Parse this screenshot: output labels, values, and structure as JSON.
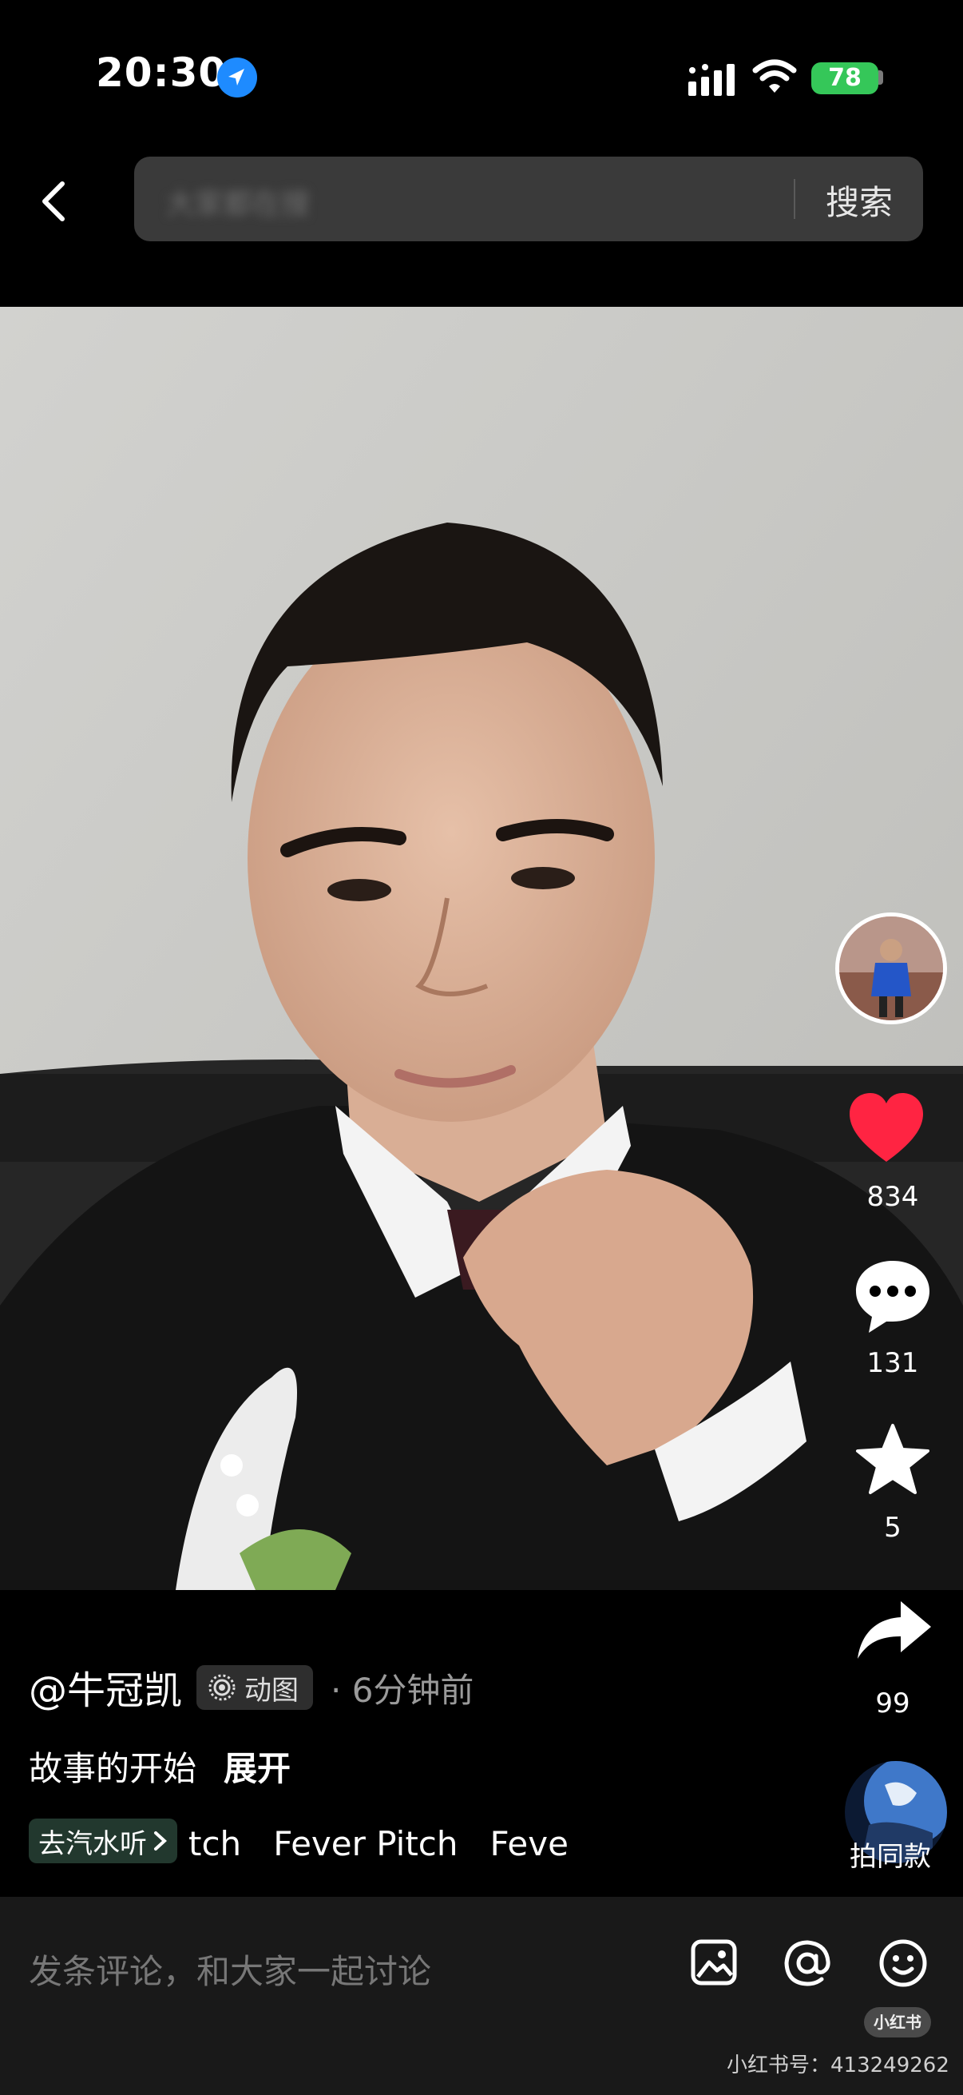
{
  "status_bar": {
    "time": "20:30",
    "battery": "78"
  },
  "search": {
    "placeholder": "大家都在搜",
    "button_label": "搜索"
  },
  "actions": {
    "likes": "834",
    "comments": "131",
    "collects": "5",
    "shares": "99",
    "same_style_label": "拍同款"
  },
  "post": {
    "author": "@牛冠凯",
    "type_label": "动图",
    "time": "· 6分钟前",
    "caption": "故事的开始",
    "expand_label": "展开",
    "music_chip": "去汽水听",
    "music_track": "tch   Fever Pitch   Feve"
  },
  "comment_bar": {
    "placeholder": "发条评论，和大家一起讨论"
  },
  "watermark": {
    "badge": "小红书",
    "id_text": "小红书号：413249262"
  },
  "colors": {
    "like": "#ff2442",
    "battery": "#35c759",
    "location": "#1e8bff"
  }
}
